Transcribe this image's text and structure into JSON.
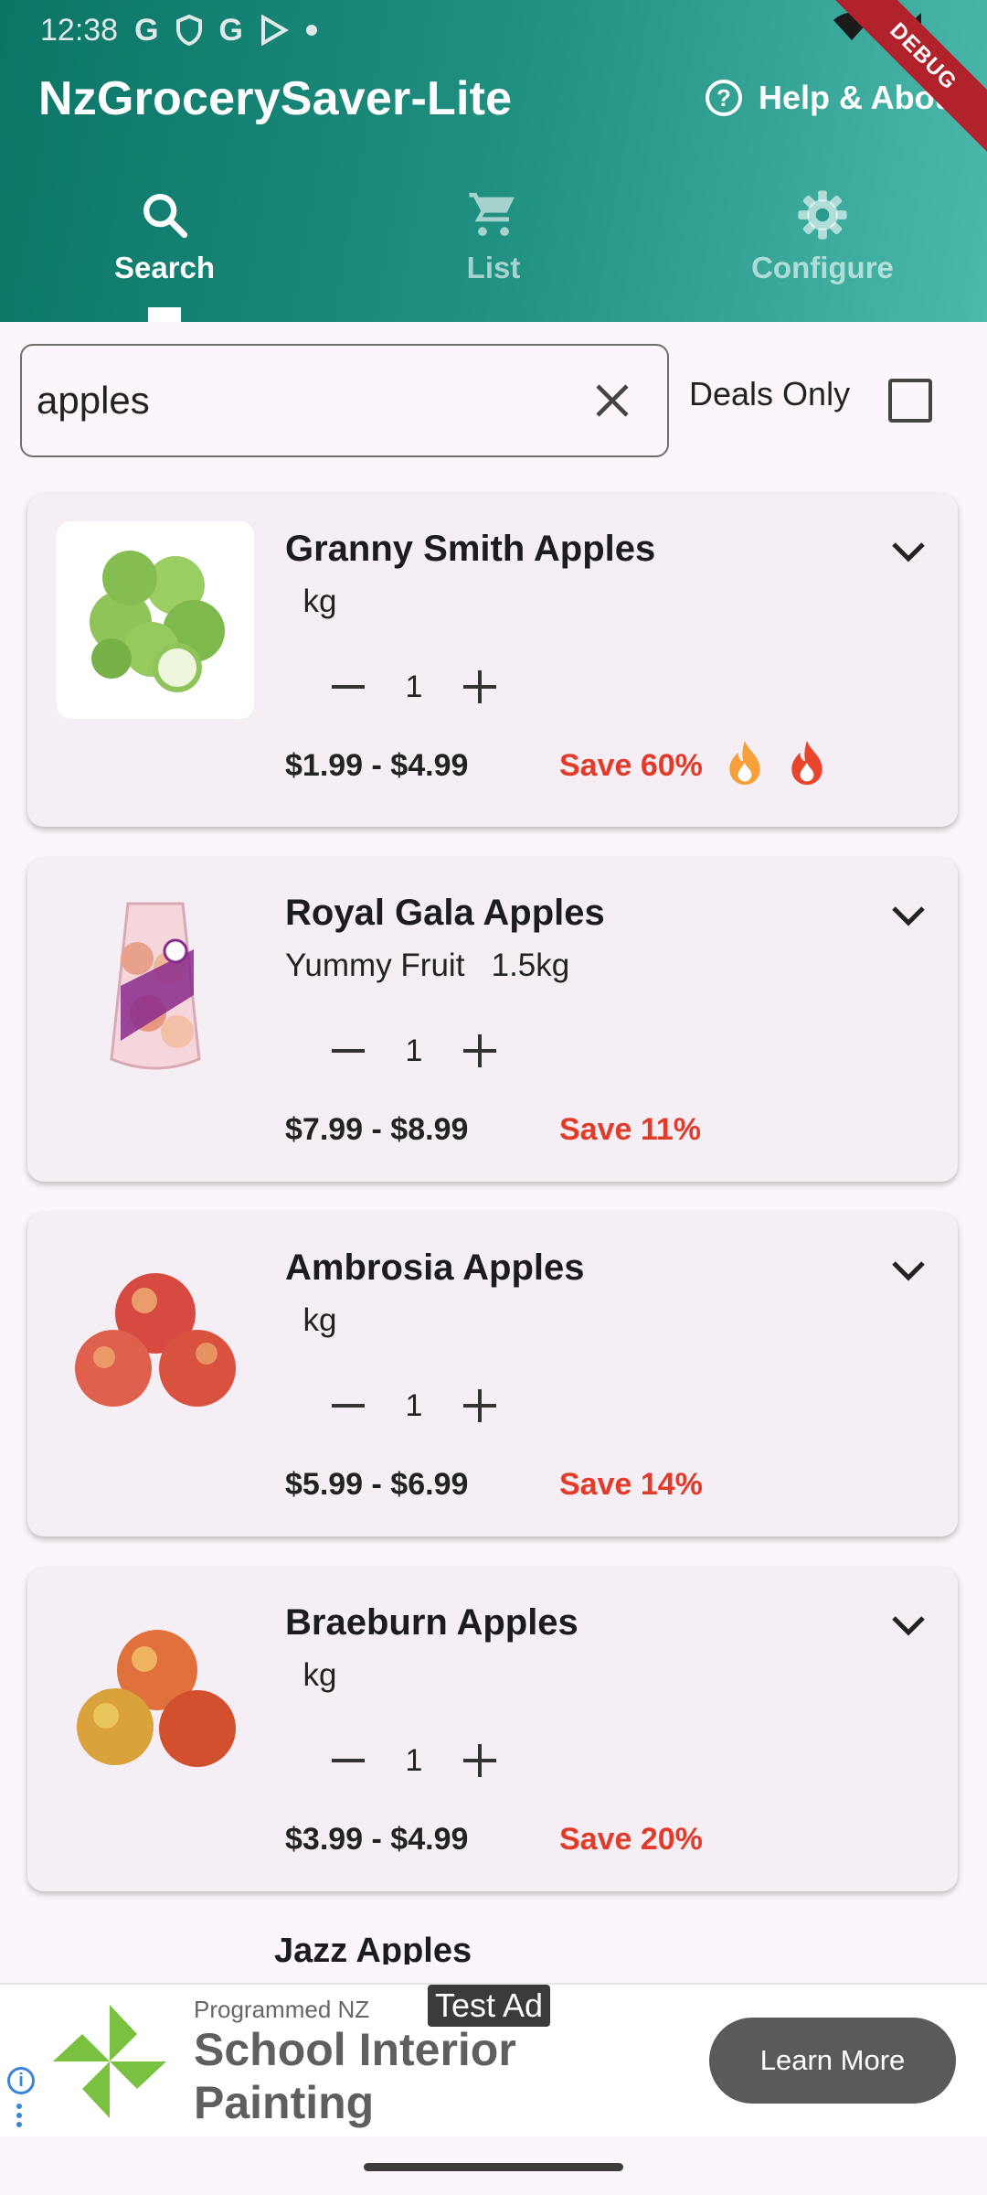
{
  "status_bar": {
    "time": "12:38",
    "icons": [
      "google-icon",
      "shield-icon",
      "google-icon",
      "play-store-icon",
      "dot-icon",
      "wifi-icon",
      "signal-icon",
      "battery-icon"
    ]
  },
  "app": {
    "title": "NzGrocerySaver-Lite",
    "help_label": "Help & About",
    "debug_banner": "DEBUG"
  },
  "tabs": [
    {
      "label": "Search",
      "icon": "search-icon",
      "active": true
    },
    {
      "label": "List",
      "icon": "cart-icon",
      "active": false
    },
    {
      "label": "Configure",
      "icon": "gear-icon",
      "active": false
    }
  ],
  "search": {
    "value": "apples",
    "deals_only_label": "Deals Only",
    "deals_only_checked": false
  },
  "products": [
    {
      "name": "Granny Smith Apples",
      "brand": "",
      "size": "kg",
      "qty": "1",
      "price": "$1.99 - $4.99",
      "save": "Save 60%",
      "flames": [
        "orange",
        "red"
      ]
    },
    {
      "name": "Royal Gala Apples",
      "brand": "Yummy Fruit",
      "size": "1.5kg",
      "qty": "1",
      "price": "$7.99 - $8.99",
      "save": "Save 11%",
      "flames": []
    },
    {
      "name": "Ambrosia Apples",
      "brand": "",
      "size": "kg",
      "qty": "1",
      "price": "$5.99 - $6.99",
      "save": "Save 14%",
      "flames": []
    },
    {
      "name": "Braeburn Apples",
      "brand": "",
      "size": "kg",
      "qty": "1",
      "price": "$3.99 - $4.99",
      "save": "Save 20%",
      "flames": []
    }
  ],
  "partial_next_item": "Jazz Apples",
  "ad": {
    "tag": "Test Ad",
    "advertiser": "Programmed NZ",
    "headline": "School Interior Painting",
    "cta": "Learn More"
  },
  "colors": {
    "header_start": "#0b7566",
    "header_end": "#4bb9ac",
    "save_red": "#e13b2b",
    "flame_orange": "#f5a03a",
    "flame_red": "#e8452c",
    "ad_logo_green": "#7ac142"
  }
}
